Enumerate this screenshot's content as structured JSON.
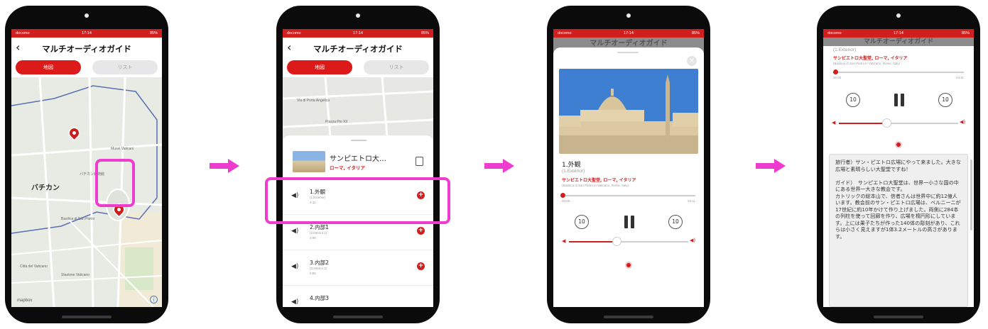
{
  "app": {
    "title": "マルチオーディオガイド",
    "tabs": {
      "map": "地図",
      "list": "リスト"
    },
    "status_carrier": "docomo",
    "status_time": "17:14",
    "status_battery": "85%"
  },
  "screen1": {
    "map_labels": {
      "big": "バチカン",
      "l1": "Musei Vaticani",
      "l2": "バチカン美術館",
      "l3": "Basilica di San Pietro",
      "l4": "Città del Vaticano",
      "l5": "Stazione Vaticano"
    },
    "map_credit": "mapbox"
  },
  "screen2": {
    "map_labels": {
      "l1": "Via di Porta Angelica",
      "l2": "Piazza Pio XII"
    },
    "place_title": "サンピエトロ大…",
    "place_subtitle": "ローマ, イタリア",
    "items": [
      {
        "title": "1.外観",
        "sub": "(1.Exterior)",
        "dur": "4:11"
      },
      {
        "title": "2.内部1",
        "sub": "(2.Interior 1)",
        "dur": "1:00"
      },
      {
        "title": "3.内部2",
        "sub": "(3.Interior 2)",
        "dur": "0:55"
      },
      {
        "title": "4.内部3",
        "sub": "",
        "dur": ""
      }
    ]
  },
  "screen3": {
    "track_title": "1.外観",
    "track_sub": "(1.Exterior)",
    "place_jp": "サンピエトロ大聖堂, ローマ, イタリア",
    "place_it": "(Basilica di San Pietro in Vaticano, Rome, Italy)",
    "time_start": "00:00",
    "time_end": "04:11",
    "skip_label": "10",
    "progress": 0.01,
    "volume": 0.4
  },
  "screen4": {
    "top_sub": "(1.Exterior)",
    "place_jp": "サンピエトロ大聖堂, ローマ, イタリア",
    "place_it": "(Basilica di San Pietro in Vaticano, Rome, Italy)",
    "time_start": "00:00",
    "time_end": "04:11",
    "skip_label": "10",
    "progress": 0.02,
    "volume": 0.4,
    "description": "旅行者）サン・ピエトロ広場にやって来ました。大きな広場と素晴らしい大聖堂ですね！\n\nガイド）　サンピエトロ大聖堂は、世界一小さな国の中にある世界一大きな教会です。\nカトリックの総本山で、信者さんは世界中に約12億人います。教会前のサン・ピエトロ広場は、ベルニーニが17世紀に約10年かけて作り上げました。両側に284本の列柱を使って回廊を作り、広場を楕円形にしています。上には果子たちが作った140体の彫刻があり、これらは小さく見えますが1体3.2メートルの高さがあります。"
  },
  "colors": {
    "accent": "#d11f1f",
    "highlight": "#ee3ccf",
    "arrow": "#ee3ccf"
  }
}
